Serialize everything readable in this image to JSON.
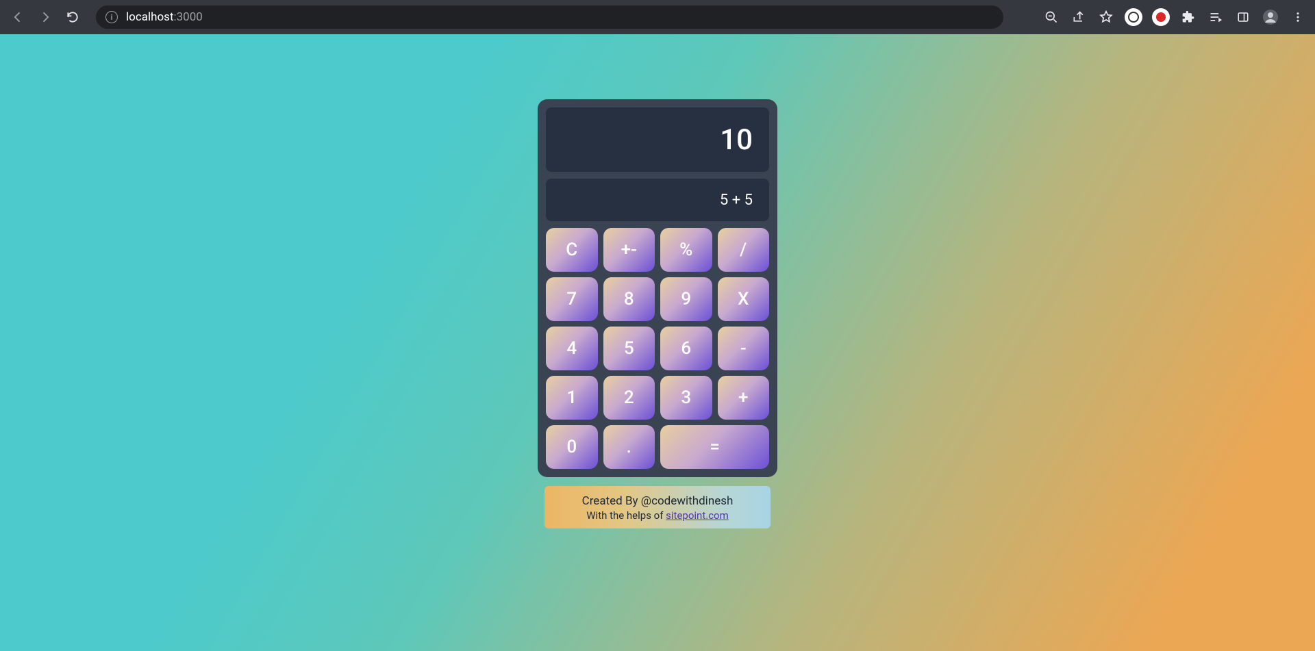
{
  "browser": {
    "url_host": "localhost",
    "url_port": ":3000"
  },
  "calc": {
    "result": "10",
    "expression": "5 + 5",
    "keys": {
      "clear": "C",
      "sign": "+-",
      "percent": "%",
      "divide": "/",
      "seven": "7",
      "eight": "8",
      "nine": "9",
      "multiply": "X",
      "four": "4",
      "five": "5",
      "six": "6",
      "minus": "-",
      "one": "1",
      "two": "2",
      "three": "3",
      "plus": "+",
      "zero": "0",
      "dot": ".",
      "equal": "="
    }
  },
  "credit": {
    "line1": "Created By @codewithdinesh",
    "line2_prefix": "With the helps of ",
    "line2_link": "sitepoint.com"
  }
}
